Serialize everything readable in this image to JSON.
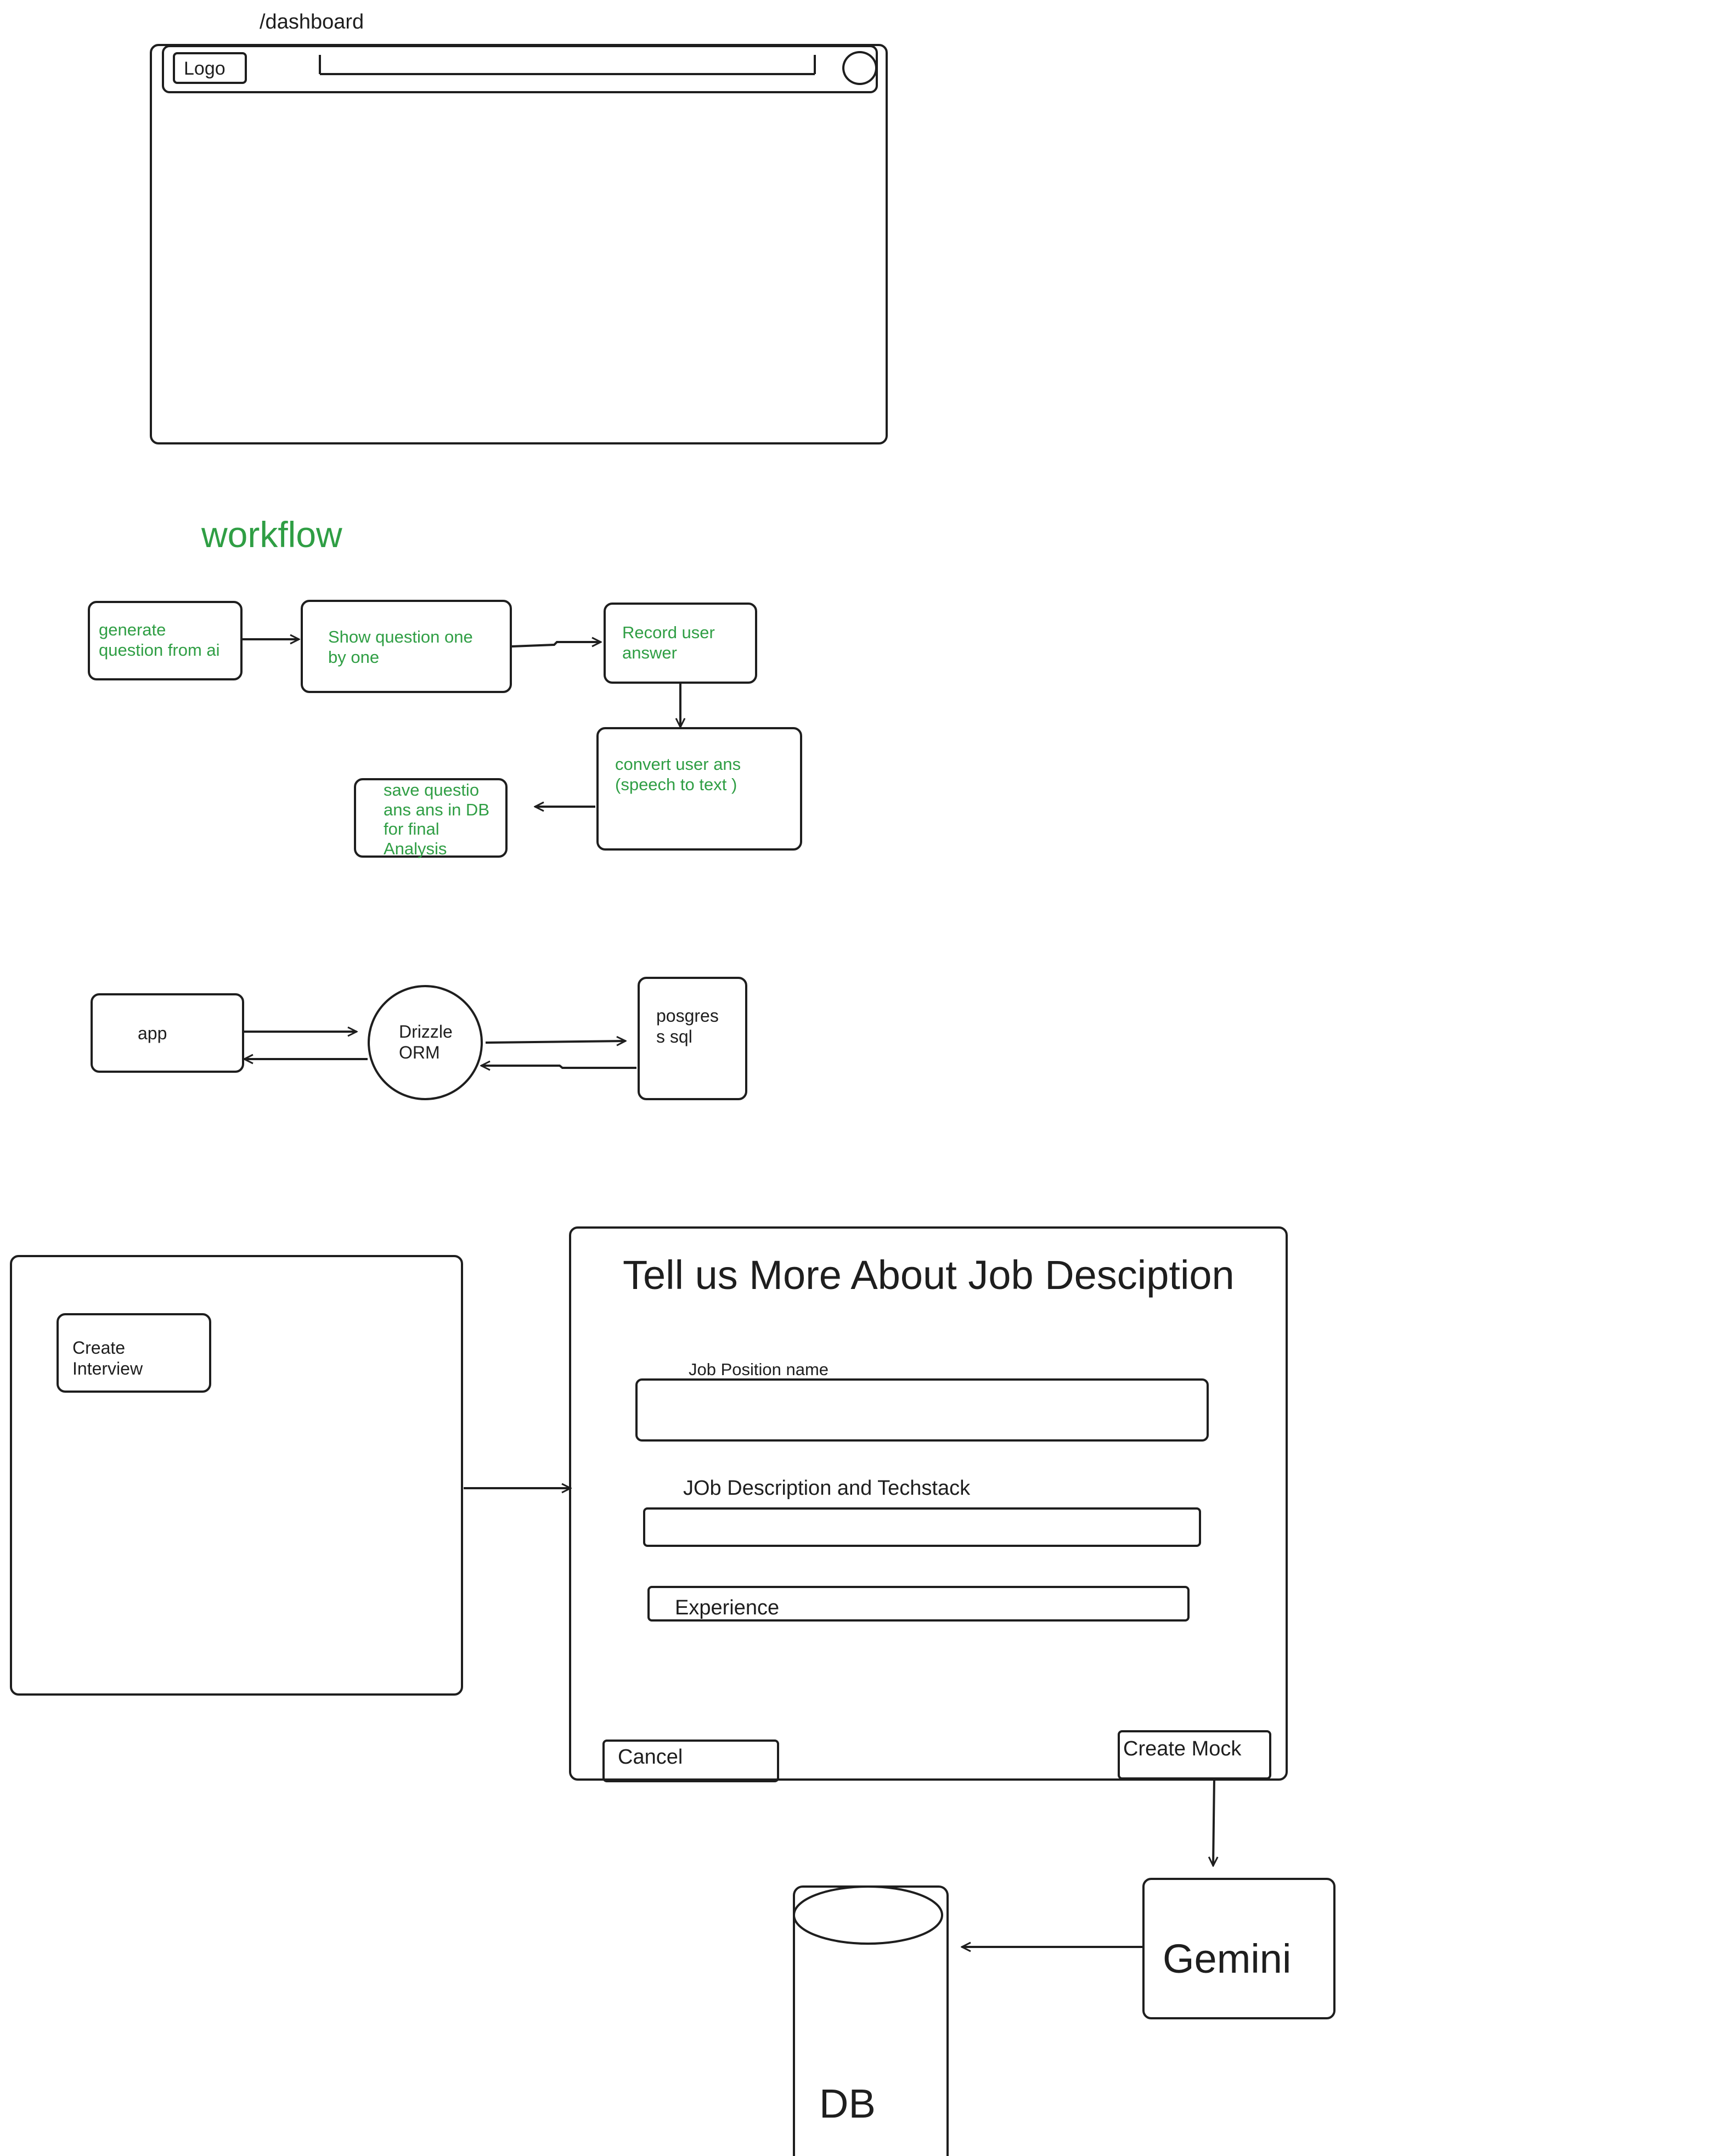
{
  "colors": {
    "stroke": "#1e1e1e",
    "workflow_text": "#2f9e44",
    "background": "#ffffff"
  },
  "dashboard": {
    "route": "/dashboard",
    "logo_label": "Logo",
    "avatar_icon": "circle-avatar-icon"
  },
  "workflow": {
    "title": "workflow",
    "steps": [
      "generate\nquestion from ai",
      "Show question one\nby one",
      "Record user\nanswer",
      "convert user ans\n(speech to text )",
      "save questio\nans ans in DB\nfor final\nAnalysis"
    ]
  },
  "architecture": {
    "app": "app",
    "orm": "Drizzle\nORM",
    "db": "posgres\ns sql"
  },
  "interview": {
    "create_button": "Create\nInterview",
    "dialog_title": "Tell us More About Job Desciption",
    "job_position_label": "Job Position name",
    "job_description_label": "JOb Description and Techstack",
    "experience_placeholder": "Experience",
    "cancel_button": "Cancel",
    "create_mock_button": "Create Mock",
    "gemini": "Gemini",
    "db": "DB"
  }
}
